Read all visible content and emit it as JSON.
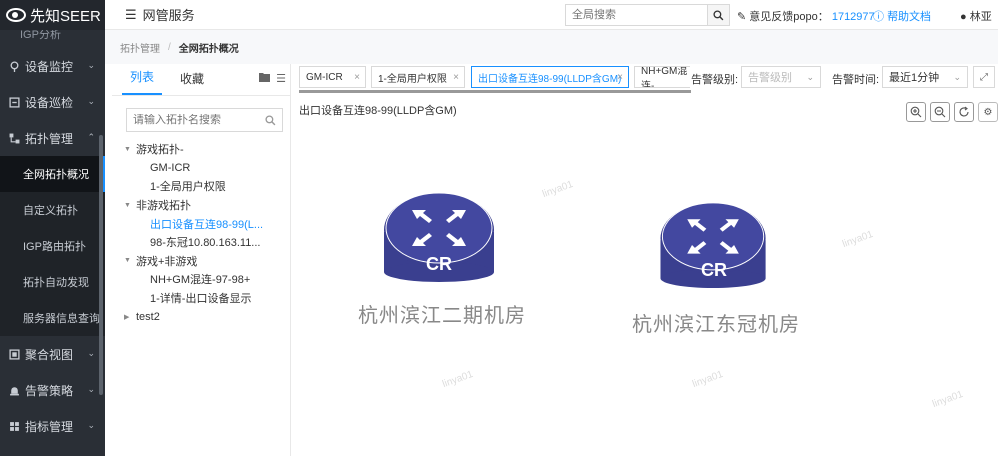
{
  "app": {
    "logo_text": "先知SEER"
  },
  "sidebar": {
    "cut_item": "IGP分析",
    "items": [
      {
        "label": "设备监控",
        "icon": "location-icon"
      },
      {
        "label": "设备巡检",
        "icon": "inspection-icon"
      },
      {
        "label": "拓扑管理",
        "icon": "topology-icon",
        "expanded": true
      }
    ],
    "sub_items": [
      "全网拓扑概况",
      "自定义拓扑",
      "IGP路由拓扑",
      "拓扑自动发现",
      "服务器信息查询"
    ],
    "active_sub": "全网拓扑概况",
    "bottom_items": [
      {
        "label": "聚合视图",
        "icon": "aggregate-icon"
      },
      {
        "label": "告警策略",
        "icon": "alarm-icon"
      },
      {
        "label": "指标管理",
        "icon": "metrics-icon"
      }
    ]
  },
  "header": {
    "menu_label": "网管服务",
    "search_placeholder": "全局搜索",
    "feedback_label": "意见反馈popo：",
    "feedback_number": "1712977",
    "help_label": "帮助文档",
    "user_name": "林亚"
  },
  "breadcrumb": {
    "parent": "拓扑管理",
    "current": "全网拓扑概况"
  },
  "left_panel": {
    "tabs": [
      "列表",
      "收藏"
    ],
    "search_placeholder": "请输入拓扑名搜索",
    "tree": [
      {
        "label": "游戏拓扑-",
        "level": 0,
        "arrow": "down"
      },
      {
        "label": "GM-ICR",
        "level": 1
      },
      {
        "label": "1-全局用户权限",
        "level": 1
      },
      {
        "label": "非游戏拓扑",
        "level": 0,
        "arrow": "down"
      },
      {
        "label": "出口设备互连98-99(L...",
        "level": 1,
        "selected": true
      },
      {
        "label": "98-东冠10.80.163.11...",
        "level": 1
      },
      {
        "label": "游戏+非游戏",
        "level": 0,
        "arrow": "down"
      },
      {
        "label": "NH+GM混连-97-98+",
        "level": 1
      },
      {
        "label": "1-详情-出口设备显示",
        "level": 1
      },
      {
        "label": "test2",
        "level": 0,
        "arrow": "right"
      }
    ]
  },
  "main": {
    "tabs": [
      "GM-ICR",
      "1-全局用户权限",
      "出口设备互连98-99(LLDP含GM)",
      "NH+GM混连-"
    ],
    "active_tab": "出口设备互连98-99(LLDP含GM)",
    "alarm_level_label": "告警级别:",
    "alarm_level_placeholder": "告警级别",
    "alarm_time_label": "告警时间:",
    "alarm_time_value": "最近1分钟",
    "topo_title": "出口设备互连98-99(LLDP含GM)",
    "nodes": [
      {
        "label": "CR",
        "name": "杭州滨江二期机房"
      },
      {
        "label": "CR",
        "name": "杭州滨江东冠机房"
      }
    ],
    "watermark": "linya01"
  },
  "colors": {
    "sidebar_bg": "#2a2f36",
    "accent": "#1890ff",
    "router_fill": "#3a3f8f"
  }
}
